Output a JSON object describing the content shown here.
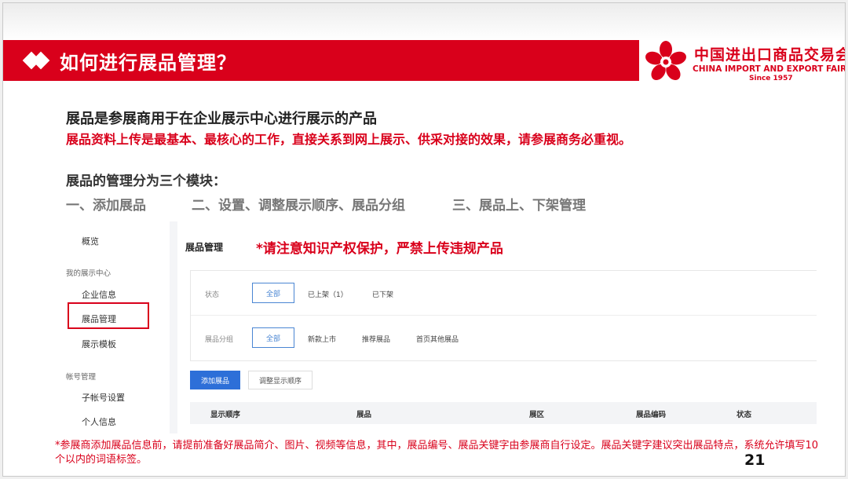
{
  "slide": {
    "title": "如何进行展品管理？",
    "logo": {
      "cn": "中国进出口商品交易会",
      "en": "CHINA IMPORT AND EXPORT FAIR",
      "since": "Since 1957",
      "color": "#d9001b"
    },
    "intro_heading": "展品是参展商用于在企业展示中心进行展示的产品",
    "intro_red": "展品资料上传是最基本、最核心的工作，直接关系到网上展示、供采对接的效果，请参展商务必重视。",
    "modules_heading": "展品的管理分为三个模块：",
    "modules": [
      "一、添加展品",
      "二、设置、调整展示顺序、展品分组",
      "三、展品上、下架管理"
    ],
    "footnote": "*参展商添加展品信息前，请提前准备好展品简介、图片、视频等信息，其中，展品编号、展品关键字由参展商自行设定。展品关键字建议突出展品特点，系统允许填写10个以内的词语标签。",
    "page_number": "21"
  },
  "screenshot": {
    "sidebar": {
      "overview": "概览",
      "group_showcase": "我的展示中心",
      "company_info": "企业信息",
      "product_management": "展品管理",
      "display_template": "展示模板",
      "group_account": "帐号管理",
      "sub_account": "子帐号设置",
      "personal_info": "个人信息"
    },
    "pane_title": "展品管理",
    "warning": "*请注意知识产权保护，严禁上传违规产品",
    "filters": {
      "status_label": "状态",
      "status_options": [
        "全部",
        "已上架（1）",
        "已下架"
      ],
      "group_label": "展品分组",
      "group_options": [
        "全部",
        "新款上市",
        "推荐展品",
        "首页其他展品"
      ]
    },
    "buttons": {
      "add": "添加展品",
      "adjust_order": "调整显示顺序"
    },
    "table_headers": [
      "显示顺序",
      "展品",
      "展区",
      "展品编码",
      "状态"
    ],
    "colors": {
      "primary_blue": "#2d6fd8",
      "highlight_red": "#d9001b"
    }
  }
}
